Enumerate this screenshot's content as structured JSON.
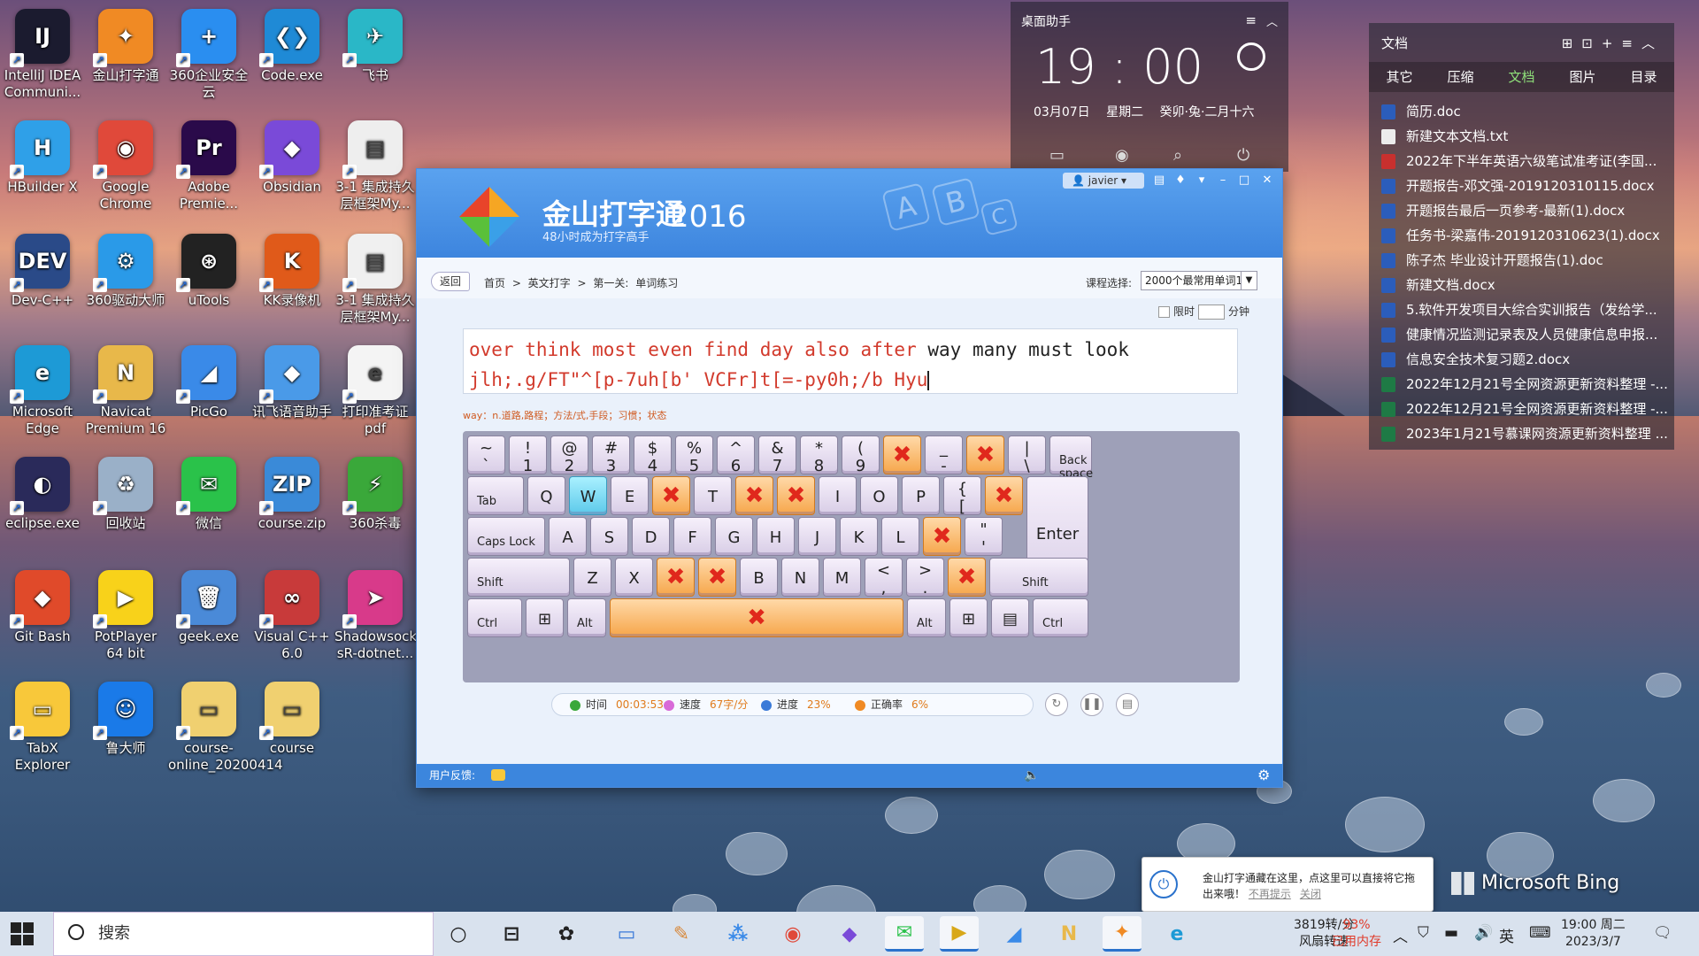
{
  "desktop": {
    "icons": [
      {
        "label": "IntelliJ IDEA Communi...",
        "glyph": "IJ",
        "color": "#1b1b2f"
      },
      {
        "label": "金山打字通",
        "glyph": "✦",
        "color": "#f08a24"
      },
      {
        "label": "360企业安全云",
        "glyph": "+",
        "color": "#2a8ef0"
      },
      {
        "label": "Code.exe",
        "glyph": "❮❯",
        "color": "#1f8ad6"
      },
      {
        "label": "飞书",
        "glyph": "✈",
        "color": "#2ab7c7"
      },
      {
        "label": "HBuilder X",
        "glyph": "H",
        "color": "#2fa0e8"
      },
      {
        "label": "Google Chrome",
        "glyph": "◉",
        "color": "#e0493a"
      },
      {
        "label": "Adobe Premie...",
        "glyph": "Pr",
        "color": "#2a0a4a"
      },
      {
        "label": "Obsidian",
        "glyph": "◆",
        "color": "#7a4ad8"
      },
      {
        "label": "3-1 集成持久层框架My...",
        "glyph": "▤",
        "color": "#eeeeee"
      },
      {
        "label": "Dev-C++",
        "glyph": "DEV",
        "color": "#2a4a88"
      },
      {
        "label": "360驱动大师",
        "glyph": "⚙",
        "color": "#2a9ae8"
      },
      {
        "label": "uTools",
        "glyph": "⊛",
        "color": "#222222"
      },
      {
        "label": "KK录像机",
        "glyph": "K",
        "color": "#e05a1a"
      },
      {
        "label": "3-1 集成持久层框架My...",
        "glyph": "▤",
        "color": "#f0f0f0"
      },
      {
        "label": "Microsoft Edge",
        "glyph": "e",
        "color": "#1d9ad6"
      },
      {
        "label": "Navicat Premium 16",
        "glyph": "N",
        "color": "#e8b84a"
      },
      {
        "label": "PicGo",
        "glyph": "◢",
        "color": "#3a8ae8"
      },
      {
        "label": "讯飞语音助手",
        "glyph": "◆",
        "color": "#4a9ae8"
      },
      {
        "label": "打印准考证pdf",
        "glyph": "e",
        "color": "#f4f4f4"
      },
      {
        "label": "eclipse.exe",
        "glyph": "◐",
        "color": "#2a2a5a"
      },
      {
        "label": "回收站",
        "glyph": "♻",
        "color": "#9ab0c8"
      },
      {
        "label": "微信",
        "glyph": "✉",
        "color": "#2ac24a"
      },
      {
        "label": "course.zip",
        "glyph": "ZIP",
        "color": "#3a8ad8"
      },
      {
        "label": "360杀毒",
        "glyph": "⚡",
        "color": "#3aa83a"
      },
      {
        "label": "Git Bash",
        "glyph": "◆",
        "color": "#e04a2a"
      },
      {
        "label": "PotPlayer 64 bit",
        "glyph": "▶",
        "color": "#f8d21a"
      },
      {
        "label": "geek.exe",
        "glyph": "🗑",
        "color": "#4a8ad8"
      },
      {
        "label": "Visual C++ 6.0",
        "glyph": "∞",
        "color": "#c83a3a"
      },
      {
        "label": "Shadowsock sR-dotnet...",
        "glyph": "➤",
        "color": "#d83a8a"
      },
      {
        "label": "TabX Explorer",
        "glyph": "▭",
        "color": "#f8c83a"
      },
      {
        "label": "鲁大师",
        "glyph": "☺",
        "color": "#1a7ae8"
      },
      {
        "label": "course-online_20200414",
        "glyph": "▭",
        "color": "#f0d070"
      },
      {
        "label": "course",
        "glyph": "▭",
        "color": "#f0d070"
      }
    ]
  },
  "widget": {
    "title": "桌面助手",
    "time": "19 : 00",
    "date": "03月07日",
    "weekday": "星期二",
    "lunar": "癸卯·兔·二月十六"
  },
  "files_panel": {
    "title": "文档",
    "tabs": [
      "其它",
      "压缩",
      "文档",
      "图片",
      "目录"
    ],
    "active_tab": "文档",
    "files": [
      {
        "name": "简历.doc",
        "type": "doc"
      },
      {
        "name": "新建文本文档.txt",
        "type": "txt"
      },
      {
        "name": "2022年下半年英语六级笔试准考证(李国...",
        "type": "pdf"
      },
      {
        "name": "开题报告-邓文强-2019120310115.docx",
        "type": "doc"
      },
      {
        "name": "开题报告最后一页参考-最新(1).docx",
        "type": "doc"
      },
      {
        "name": "任务书-梁嘉伟-2019120310623(1).docx",
        "type": "doc"
      },
      {
        "name": "陈子杰 毕业设计开题报告(1).doc",
        "type": "doc"
      },
      {
        "name": "新建文档.docx",
        "type": "doc"
      },
      {
        "name": "5.软件开发项目大综合实训报告（发给学...",
        "type": "doc"
      },
      {
        "name": "健康情况监测记录表及人员健康信息申报...",
        "type": "doc"
      },
      {
        "name": "信息安全技术复习题2.docx",
        "type": "doc"
      },
      {
        "name": "2022年12月21号全网资源更新资料整理 -...",
        "type": "xls"
      },
      {
        "name": "2022年12月21号全网资源更新资料整理 -...",
        "type": "xls"
      },
      {
        "name": "2023年1月21号慕课网资源更新资料整理 ...",
        "type": "xls"
      }
    ]
  },
  "app": {
    "brand": "金山打字通",
    "year": "2016",
    "slogan": "48小时成为打字高手",
    "user": "javier",
    "back": "返回",
    "breadcrumb": "首页 > 英文打字 > 第一关: 单词练习",
    "course_label": "课程选择:",
    "course_value": "2000个最常用单词1",
    "limit_label": "限时",
    "limit_unit": "分钟",
    "target_done": "over think most even find day also after",
    "target_todo": " way many must look",
    "typed": "jlh;.g/FT\"^[p-7uh[b' VCFr]t[=-py0h;/b Hyu",
    "hint": "way：n.道路,路程；方法/式,手段；习惯；状态",
    "stats": {
      "time_label": "时间",
      "time": "00:03:53",
      "speed_label": "速度",
      "speed": "67字/分",
      "progress_label": "进度",
      "progress": "23%",
      "accuracy_label": "正确率",
      "accuracy": "6%"
    },
    "feedback": "用户反馈:"
  },
  "keyboard": {
    "row1": [
      {
        "top": "~",
        "bot": "`"
      },
      {
        "top": "!",
        "bot": "1"
      },
      {
        "top": "@",
        "bot": "2"
      },
      {
        "top": "#",
        "bot": "3"
      },
      {
        "top": "$",
        "bot": "4"
      },
      {
        "top": "%",
        "bot": "5"
      },
      {
        "top": "^",
        "bot": "6"
      },
      {
        "top": "&",
        "bot": "7"
      },
      {
        "top": "*",
        "bot": "8"
      },
      {
        "top": "(",
        "bot": "9"
      },
      {
        "top": "",
        "bot": "",
        "bad": true
      },
      {
        "top": "_",
        "bot": "-"
      },
      {
        "top": "",
        "bot": "",
        "bad": true
      },
      {
        "top": "|",
        "bot": "\\"
      }
    ],
    "backspace": "Back space",
    "tab": "Tab",
    "row2": [
      "Q",
      "W",
      "E",
      "!R",
      "T",
      "!Y",
      "!U",
      "I",
      "O",
      "P",
      "{[",
      "!]"
    ],
    "caps": "Caps Lock",
    "row3": [
      "A",
      "S",
      "D",
      "F",
      "G",
      "H",
      "J",
      "K",
      "L",
      "!;",
      "\"'"
    ],
    "enter": "Enter",
    "shift": "Shift",
    "row4": [
      "Z",
      "X",
      "!C",
      "!V",
      "B",
      "N",
      "M",
      "<,",
      ">.",
      "!/"
    ],
    "ctrl": "Ctrl",
    "alt": "Alt"
  },
  "notification": {
    "text": "金山打字通藏在这里，点这里可以直接将它拖出来哦！",
    "link1": "不再提示",
    "link2": "关闭"
  },
  "bing": "Microsoft Bing",
  "taskbar": {
    "search": "搜索",
    "speed_value": "3819转/分",
    "speed_label": "风扇转速",
    "mem_value": "93%",
    "mem_label": "已用内存",
    "ime": "英",
    "time": "19:00 周二",
    "date": "2023/3/7"
  }
}
